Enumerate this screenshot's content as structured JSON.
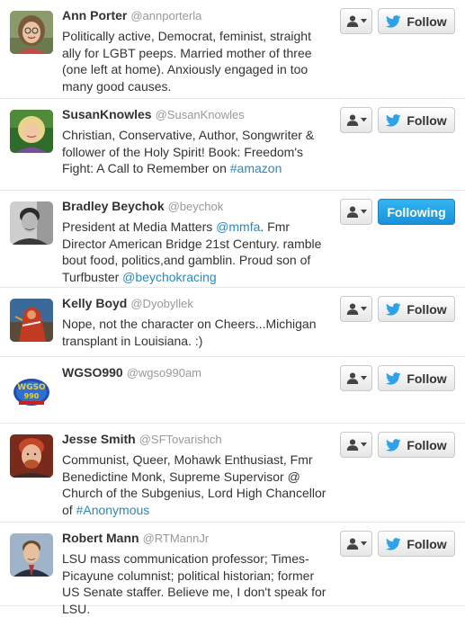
{
  "users": [
    {
      "name": "Ann Porter",
      "handle": "@annporterla",
      "bio": [
        {
          "text": "Politically active, Democrat, feminist, straight ally for LGBT peeps. Married mother of three (one left at home). Anxiously engaged in too many good causes.",
          "link": false
        }
      ],
      "follow_label": "Follow",
      "following": false,
      "avatar": "woman-glasses-avatar"
    },
    {
      "name": "SusanKnowles",
      "handle": "@SusanKnowles",
      "bio": [
        {
          "text": "Christian, Conservative, Author, Songwriter & follower of the Holy Spirit! Book: Freedom's Fight: A Call to Remember on ",
          "link": false
        },
        {
          "text": "#amazon",
          "link": true
        }
      ],
      "follow_label": "Follow",
      "following": false,
      "avatar": "blonde-woman-avatar"
    },
    {
      "name": "Bradley Beychok",
      "handle": "@beychok",
      "bio": [
        {
          "text": "President at Media Matters ",
          "link": false
        },
        {
          "text": "@mmfa",
          "link": true
        },
        {
          "text": ". Fmr Director American Bridge 21st Century. ramble bout food, politics,and gamblin. Proud son of Turfbuster ",
          "link": false
        },
        {
          "text": "@beychokracing",
          "link": true
        }
      ],
      "follow_label": "Following",
      "following": true,
      "avatar": "man-bw-avatar"
    },
    {
      "name": "Kelly Boyd",
      "handle": "@Dyobyllek",
      "bio": [
        {
          "text": "Nope, not the character on Cheers...Michigan transplant in Louisiana. :)",
          "link": false
        }
      ],
      "follow_label": "Follow",
      "following": false,
      "avatar": "red-costume-avatar"
    },
    {
      "name": "WGSO990",
      "handle": "@wgso990am",
      "bio": [],
      "follow_label": "Follow",
      "following": false,
      "avatar": "radio-logo-avatar"
    },
    {
      "name": "Jesse Smith",
      "handle": "@SFTovarishch",
      "bio": [
        {
          "text": "Communist, Queer, Mohawk Enthusiast, Fmr Benedictine Monk, Supreme Supervisor @ Church of the Subgenius, Lord High Chancellor of ",
          "link": false
        },
        {
          "text": "#Anonymous",
          "link": true
        }
      ],
      "follow_label": "Follow",
      "following": false,
      "avatar": "red-hair-man-avatar"
    },
    {
      "name": "Robert Mann",
      "handle": "@RTMannJr",
      "bio": [
        {
          "text": "LSU mass communication professor; Times-Picayune columnist; political historian; former US Senate staffer. Believe me, I don't speak for LSU.",
          "link": false
        }
      ],
      "follow_label": "Follow",
      "following": false,
      "avatar": "man-suit-avatar"
    }
  ],
  "colors": {
    "link": "#2a89bf",
    "twitter_bird": "#2ea1e8",
    "following_bg": "#1a91da",
    "handle": "#999999"
  }
}
